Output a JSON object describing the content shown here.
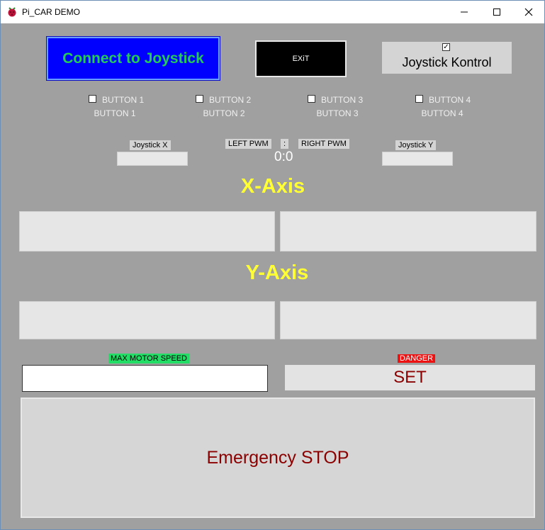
{
  "window": {
    "title": "Pi_CAR DEMO",
    "icon": "raspberry-pi-icon",
    "controls": {
      "minimize": "minimize-icon",
      "maximize": "maximize-icon",
      "close": "close-icon"
    }
  },
  "top": {
    "connect_label": "Connect to Joystick",
    "exit_label": "EXiT",
    "kontrol_label": "Joystick Kontrol",
    "kontrol_checked": true,
    "kontrol_check_glyph": "✓"
  },
  "buttons": [
    {
      "label": "BUTTON 1",
      "sub": "BUTTON 1",
      "checked": false
    },
    {
      "label": "BUTTON 2",
      "sub": "BUTTON 2",
      "checked": false
    },
    {
      "label": "BUTTON 3",
      "sub": "BUTTON 3",
      "checked": false
    },
    {
      "label": "BUTTON 4",
      "sub": "BUTTON 4",
      "checked": false
    }
  ],
  "readouts": {
    "joystick_x_label": "Joystick X",
    "joystick_y_label": "Joystick Y",
    "left_pwm_label": "LEFT PWM",
    "separator": ":",
    "right_pwm_label": "RIGHT PWM",
    "pwm_value": "0:0"
  },
  "axes": {
    "x_title": "X-Axis",
    "y_title": "Y-Axis"
  },
  "bottom": {
    "max_speed_label": "MAX MOTOR SPEED",
    "speed_value": "",
    "danger_label": "DANGER",
    "set_label": "SET",
    "stop_label": "Emergency STOP"
  },
  "colors": {
    "background": "#a0a0a0",
    "connect_bg": "#0000ff",
    "connect_text": "#22cc55",
    "axis_title": "#ffff33",
    "danger_bg": "#ee1111",
    "max_speed_bg": "#22dd66",
    "set_text": "#8b0000"
  }
}
